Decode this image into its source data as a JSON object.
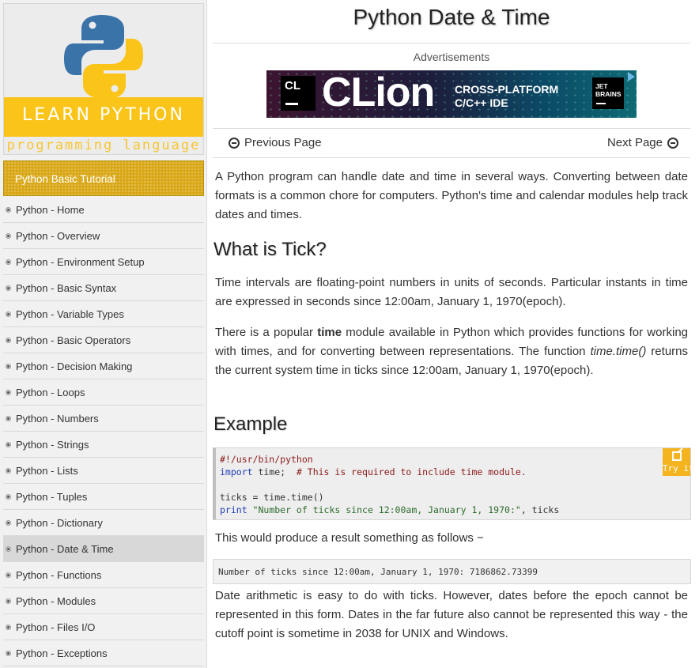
{
  "logo": {
    "main_text": "LEARN PYTHON",
    "tagline": "programming language",
    "colors": {
      "blue": "#3a73a8",
      "yellow": "#fbc419"
    }
  },
  "sidebar": {
    "heading": "Python Basic Tutorial",
    "active": "Python - Date & Time",
    "items": [
      "Python - Home",
      "Python - Overview",
      "Python - Environment Setup",
      "Python - Basic Syntax",
      "Python - Variable Types",
      "Python - Basic Operators",
      "Python - Decision Making",
      "Python - Loops",
      "Python - Numbers",
      "Python - Strings",
      "Python - Lists",
      "Python - Tuples",
      "Python - Dictionary",
      "Python - Date & Time",
      "Python - Functions",
      "Python - Modules",
      "Python - Files I/O",
      "Python - Exceptions"
    ]
  },
  "page": {
    "title": "Python Date & Time",
    "ads_label": "Advertisements",
    "ad": {
      "logo_text": "CL",
      "brand": "CLion",
      "line1": "CROSS-PLATFORM",
      "line2": "C/C++ IDE",
      "vendor_line1": "JET",
      "vendor_line2": "BRAINS"
    },
    "nav": {
      "prev": "Previous Page",
      "next": "Next Page"
    },
    "intro": "A Python program can handle date and time in several ways. Converting between date formats is a common chore for computers. Python's time and calendar modules help track dates and times.",
    "h_tick": "What is Tick?",
    "tick_p1": "Time intervals are floating-point numbers in units of seconds. Particular instants in time are expressed in seconds since 12:00am, January 1, 1970(epoch).",
    "tick_p2_a": "There is a popular ",
    "tick_p2_b": "time",
    "tick_p2_c": " module available in Python which provides functions for working with times, and for converting between representations. The function ",
    "tick_p2_d": "time.time()",
    "tick_p2_e": " returns the current system time in ticks since 12:00am, January 1, 1970(epoch).",
    "h_example": "Example",
    "code": {
      "l1": "#!/usr/bin/python",
      "l2_kw": "import",
      "l2_rest": " time;  ",
      "l2_comment": "# This is required to include time module.",
      "l4": "ticks = time.time()",
      "l5_kw": "print",
      "l5_str": " \"Number of ticks since 12:00am, January 1, 1970:\"",
      "l5_rest": ", ticks"
    },
    "try_it": "Try it",
    "result_intro": "This would produce a result something as follows −",
    "output": "Number of ticks since 12:00am, January 1, 1970: 7186862.73399",
    "closing": "Date arithmetic is easy to do with ticks. However, dates before the epoch cannot be represented in this form. Dates in the far future also cannot be represented this way - the cutoff point is sometime in 2038 for UNIX and Windows."
  }
}
